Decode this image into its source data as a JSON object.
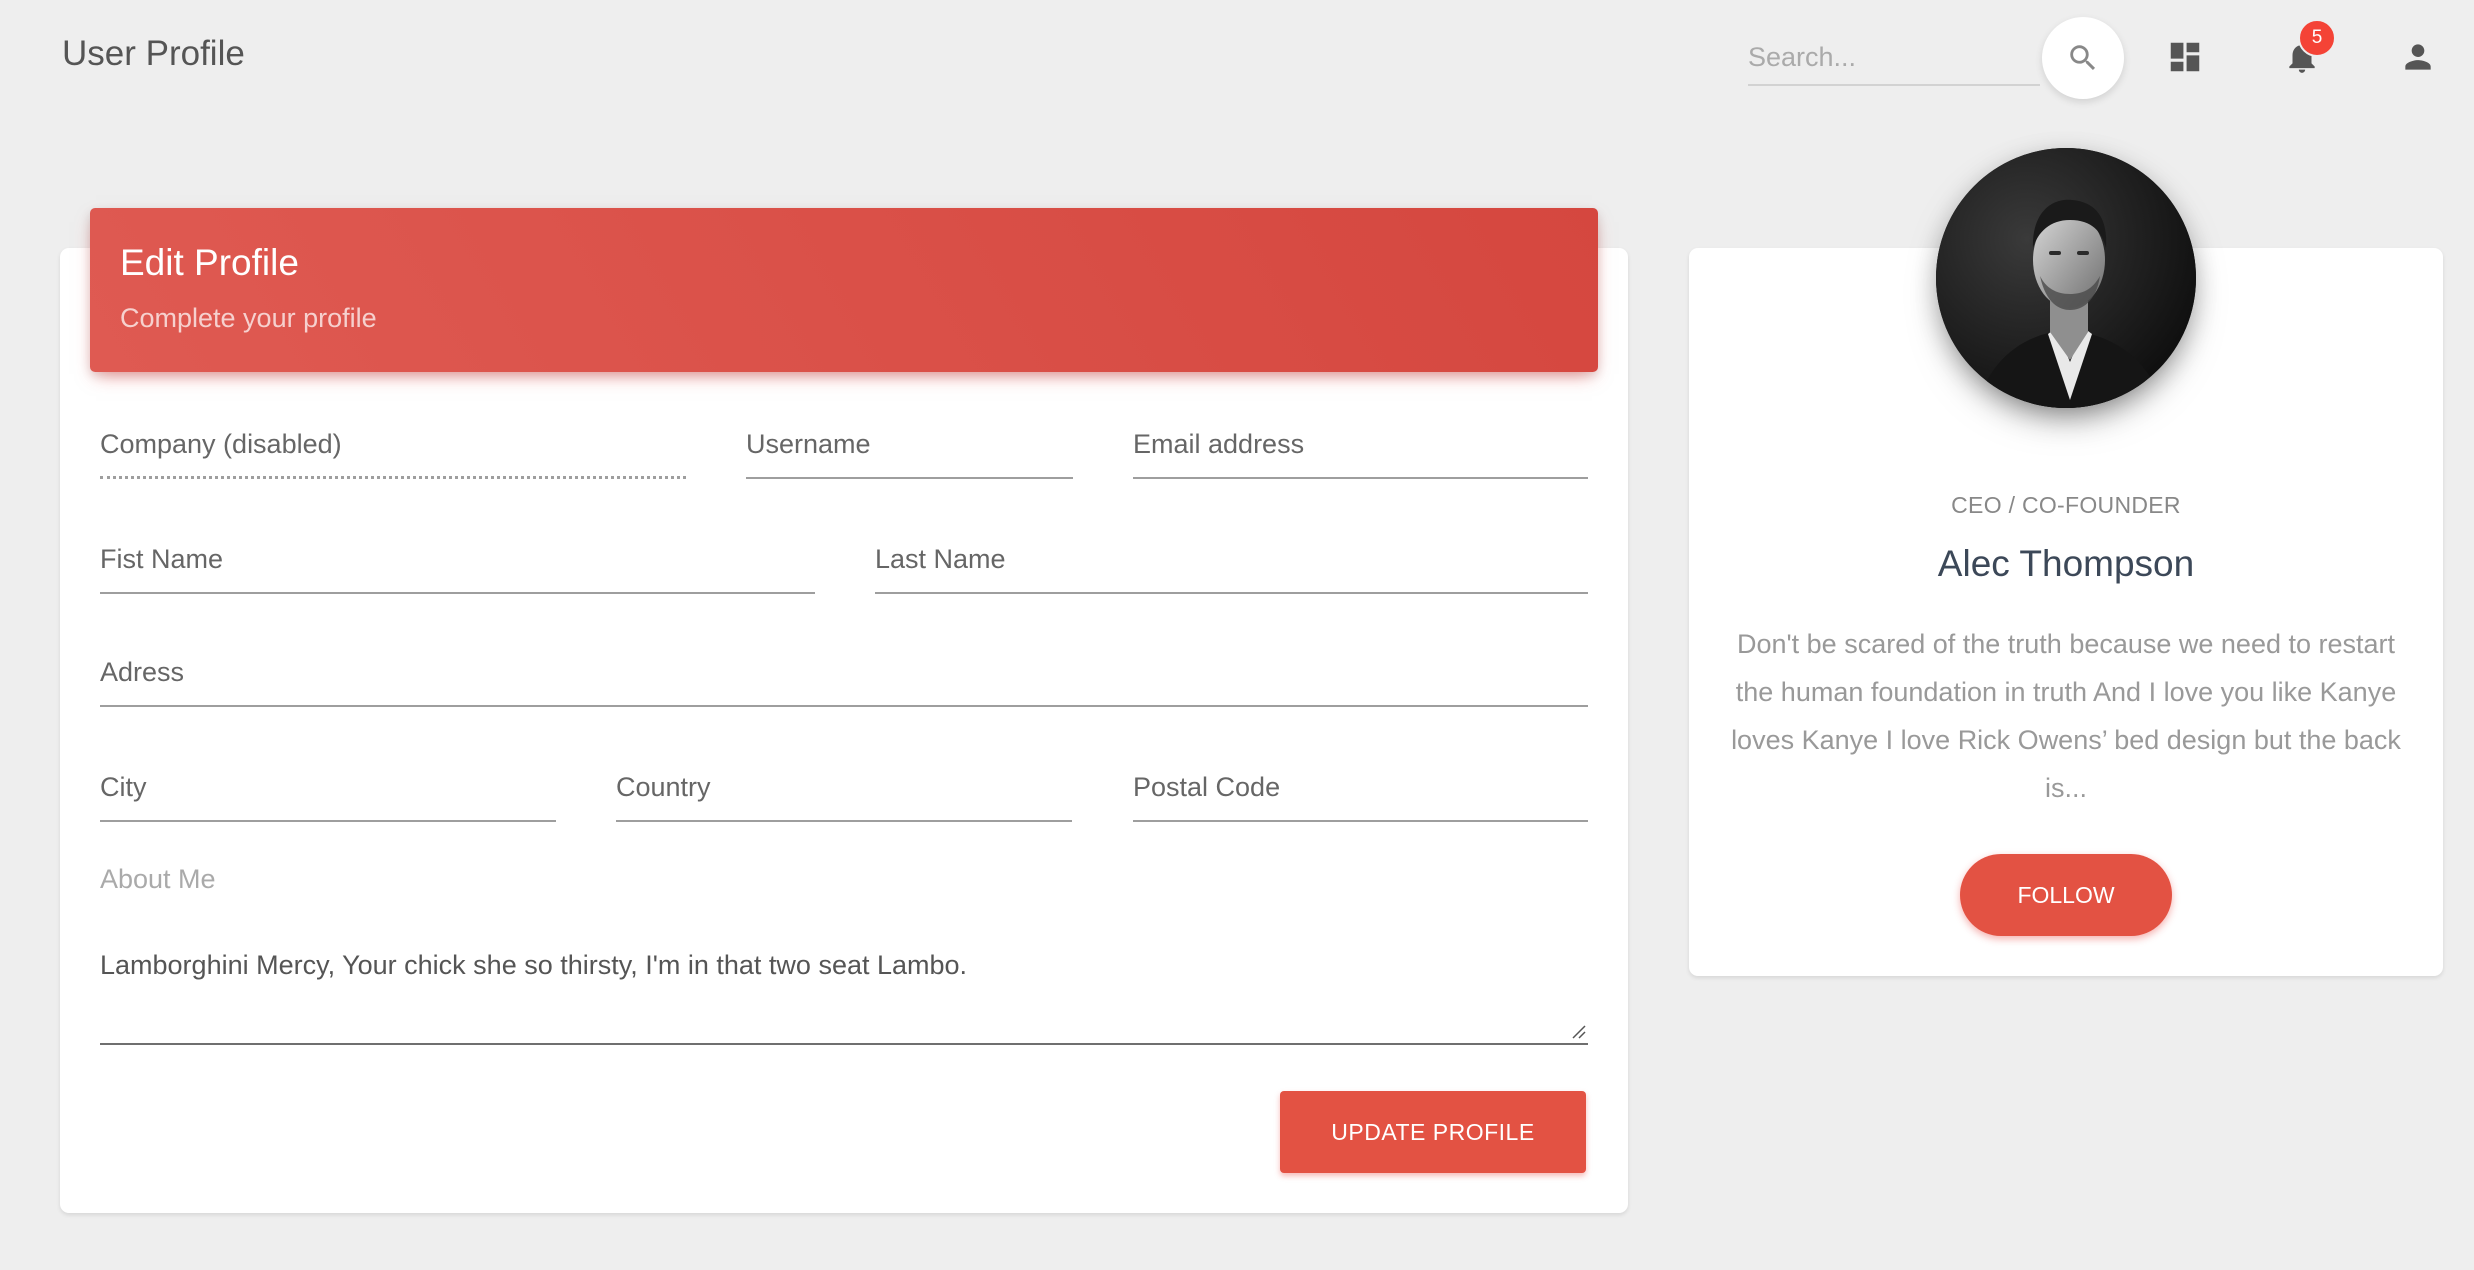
{
  "navbar": {
    "title": "User Profile",
    "search_placeholder": "Search...",
    "notification_count": "5"
  },
  "edit_profile": {
    "title": "Edit Profile",
    "subtitle": "Complete your profile",
    "fields": {
      "company": "Company (disabled)",
      "username": "Username",
      "email": "Email address",
      "first_name": "Fist Name",
      "last_name": "Last Name",
      "address": "Adress",
      "city": "City",
      "country": "Country",
      "postal_code": "Postal Code"
    },
    "about_label": "About Me",
    "about_text": "Lamborghini Mercy, Your chick she so thirsty, I'm in that two seat Lambo.",
    "update_button": "UPDATE PROFILE"
  },
  "profile": {
    "role": "CEO / CO-FOUNDER",
    "name": "Alec Thompson",
    "description": "Don't be scared of the truth because we need to restart the human foundation in truth And I love you like Kanye loves Kanye I love Rick Owens’ bed design but the back is...",
    "follow_button": "FOLLOW"
  },
  "colors": {
    "accent": "#e35243",
    "header_gradient_start": "#df5a52",
    "header_gradient_end": "#d5473f",
    "background": "#eeeeee"
  },
  "icons": {
    "search": "search-icon",
    "dashboard": "dashboard-icon",
    "notifications": "bell-icon",
    "user": "person-icon"
  }
}
